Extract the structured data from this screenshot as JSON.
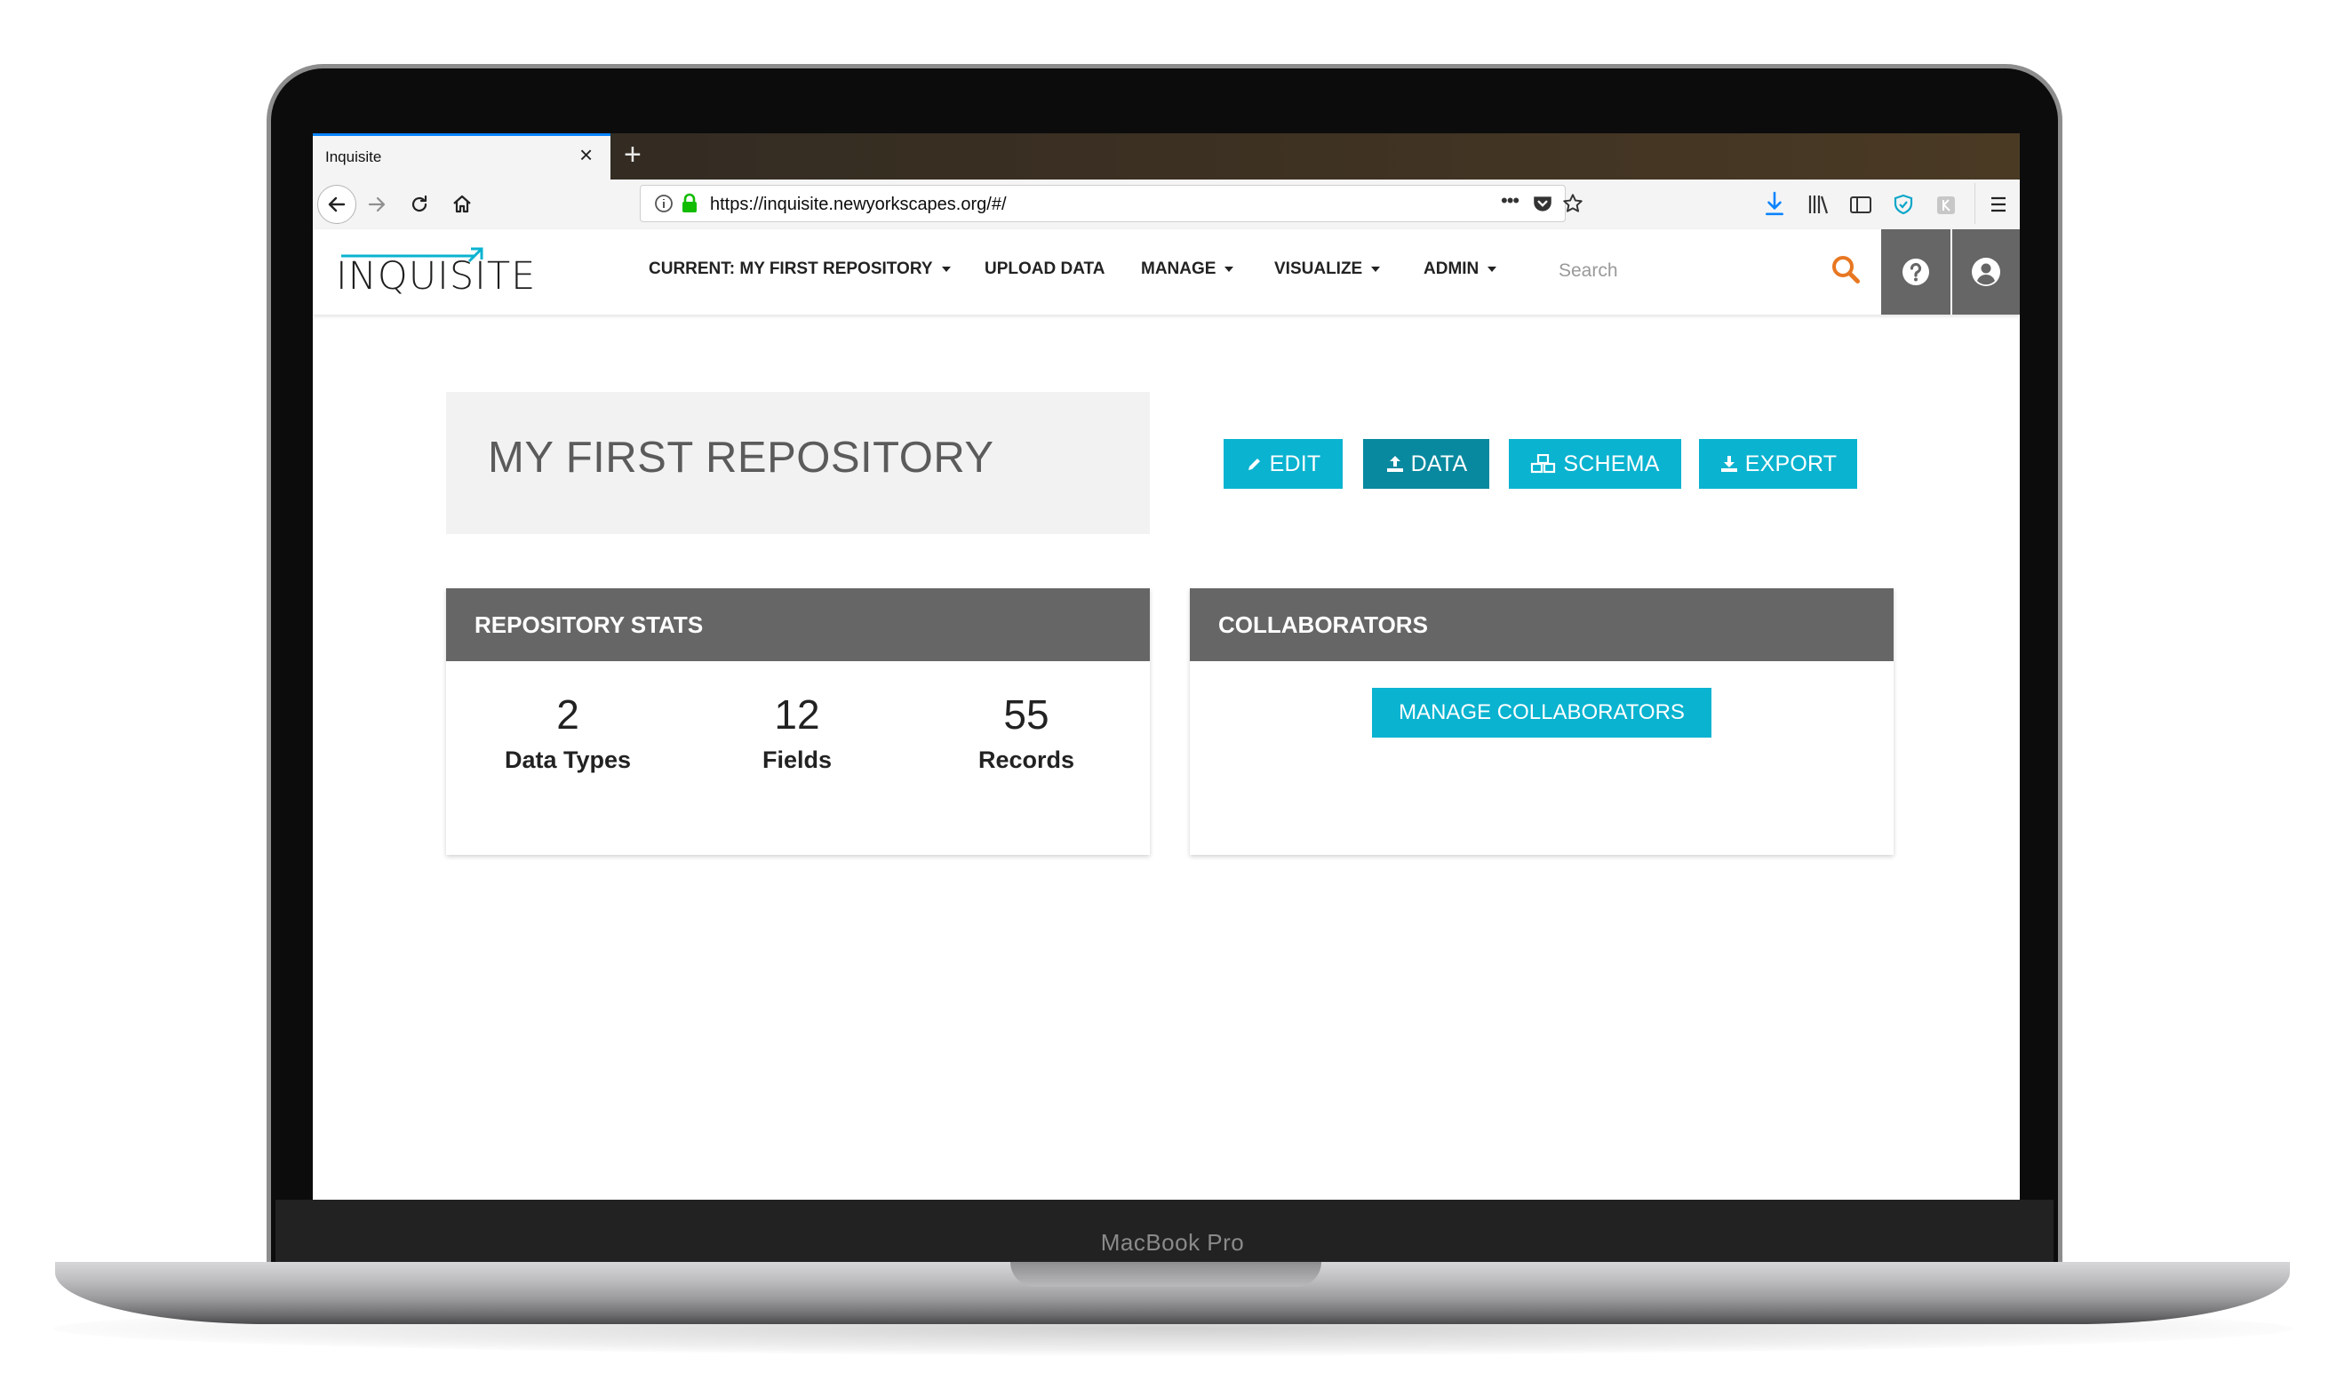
{
  "device": {
    "brand_label": "MacBook Pro"
  },
  "browser": {
    "tab_title": "Inquisite",
    "tab_close": "×",
    "new_tab": "+",
    "url": "https://inquisite.newyorkscapes.org/#/",
    "page_actions": "•••"
  },
  "app": {
    "logo": "INQUISITE",
    "nav": [
      {
        "label": "CURRENT: MY FIRST REPOSITORY",
        "dropdown": true
      },
      {
        "label": "UPLOAD DATA",
        "dropdown": false
      },
      {
        "label": "MANAGE",
        "dropdown": true
      },
      {
        "label": "VISUALIZE",
        "dropdown": true
      },
      {
        "label": "ADMIN",
        "dropdown": true
      }
    ],
    "search_placeholder": "Search"
  },
  "repository": {
    "title": "MY FIRST REPOSITORY",
    "actions": [
      {
        "label": "EDIT",
        "icon": "pencil-icon"
      },
      {
        "label": "DATA",
        "icon": "upload-icon"
      },
      {
        "label": "SCHEMA",
        "icon": "cubes-icon"
      },
      {
        "label": "EXPORT",
        "icon": "download-icon"
      }
    ]
  },
  "stats_panel": {
    "title": "REPOSITORY STATS",
    "stats": [
      {
        "value": "2",
        "label": "Data Types"
      },
      {
        "value": "12",
        "label": "Fields"
      },
      {
        "value": "55",
        "label": "Records"
      }
    ]
  },
  "collaborators_panel": {
    "title": "COLLABORATORS",
    "button": "MANAGE COLLABORATORS"
  },
  "colors": {
    "accent": "#0ab3d0",
    "accent_dark": "#08899f",
    "panel_header": "#666666",
    "search_icon": "#e87722"
  }
}
